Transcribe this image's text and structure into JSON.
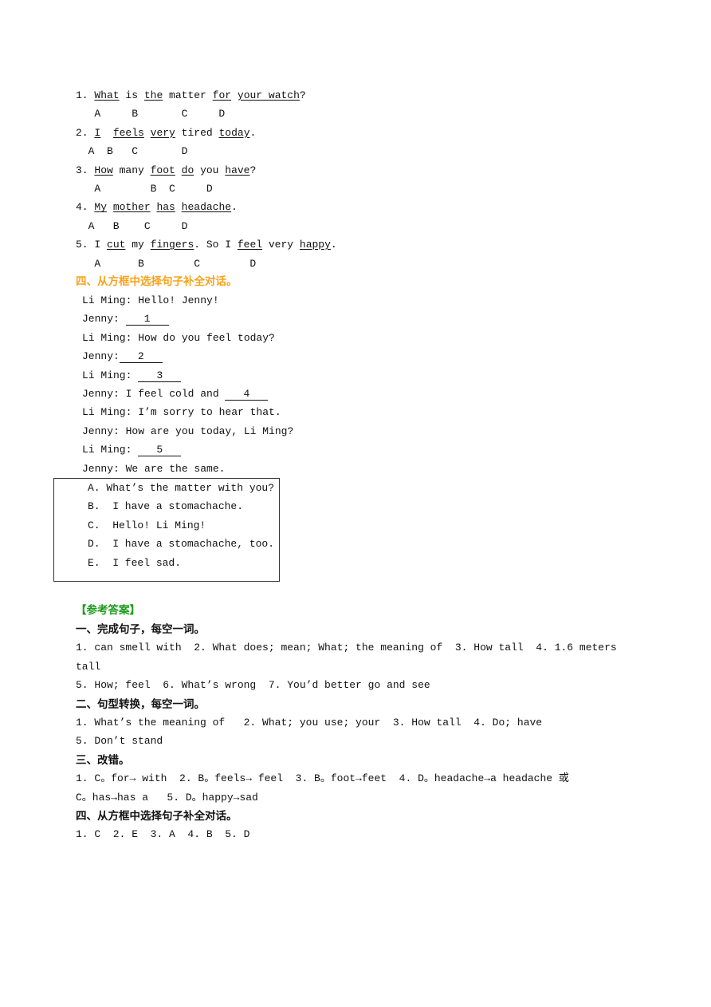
{
  "section3_questions": [
    {
      "parts": [
        {
          "t": "1. "
        },
        {
          "t": "What",
          "u": true
        },
        {
          "t": " is "
        },
        {
          "t": "the",
          "u": true
        },
        {
          "t": " matter "
        },
        {
          "t": "for",
          "u": true
        },
        {
          "t": " "
        },
        {
          "t": "your watch",
          "u": true
        },
        {
          "t": "?"
        }
      ],
      "letters": "   A     B       C     D"
    },
    {
      "parts": [
        {
          "t": "2. "
        },
        {
          "t": "I",
          "u": true
        },
        {
          "t": "  "
        },
        {
          "t": "feels",
          "u": true
        },
        {
          "t": " "
        },
        {
          "t": "very",
          "u": true
        },
        {
          "t": " tired "
        },
        {
          "t": "today",
          "u": true
        },
        {
          "t": "."
        }
      ],
      "letters": "  A  B   C       D"
    },
    {
      "parts": [
        {
          "t": "3. "
        },
        {
          "t": "How",
          "u": true
        },
        {
          "t": " many "
        },
        {
          "t": "foot",
          "u": true
        },
        {
          "t": " "
        },
        {
          "t": "do",
          "u": true
        },
        {
          "t": " you "
        },
        {
          "t": "have",
          "u": true
        },
        {
          "t": "?"
        }
      ],
      "letters": "   A        B  C     D"
    },
    {
      "parts": [
        {
          "t": "4. "
        },
        {
          "t": "My",
          "u": true
        },
        {
          "t": " "
        },
        {
          "t": "mother",
          "u": true
        },
        {
          "t": " "
        },
        {
          "t": "has",
          "u": true
        },
        {
          "t": " "
        },
        {
          "t": "headache",
          "u": true
        },
        {
          "t": "."
        }
      ],
      "letters": "  A   B    C     D"
    },
    {
      "parts": [
        {
          "t": "5. I "
        },
        {
          "t": "cut",
          "u": true
        },
        {
          "t": " my "
        },
        {
          "t": "fingers",
          "u": true
        },
        {
          "t": ". So I "
        },
        {
          "t": "feel",
          "u": true
        },
        {
          "t": " very "
        },
        {
          "t": "happy",
          "u": true
        },
        {
          "t": "."
        }
      ],
      "letters": "   A      B        C        D"
    }
  ],
  "section4": {
    "heading": "四、从方框中选择句子补全对话。",
    "dialogue": [
      {
        "text": "Li Ming: Hello! Jenny!"
      },
      {
        "text": "Jenny: ",
        "blank": "1"
      },
      {
        "text": "Li Ming: How do you feel today?"
      },
      {
        "text": "Jenny:",
        "blank": "2"
      },
      {
        "text": "Li Ming: ",
        "blank": "3"
      },
      {
        "text": "Jenny: I feel cold and ",
        "blank": "4"
      },
      {
        "text": "Li Ming: I’m sorry to hear that."
      },
      {
        "text": "Jenny: How are you today, Li Ming?"
      },
      {
        "text": "Li Ming: ",
        "blank": "5"
      },
      {
        "text": "Jenny: We are the same."
      }
    ],
    "options": [
      "A. What’s the matter with you?",
      "B.  I have a stomachache.",
      "C.  Hello! Li Ming!",
      "D.  I have a stomachache, too.",
      "E.  I feel sad."
    ]
  },
  "answers": {
    "title": "【参考答案】",
    "lines": [
      {
        "t": "一、完成句子，每空一词。",
        "h": true
      },
      {
        "t": "1. can smell with  2. What does; mean; What; the meaning of  3. How tall  4. 1.6 meters"
      },
      {
        "t": "tall"
      },
      {
        "t": "5. How; feel  6. What’s wrong  7. You’d better go and see"
      },
      {
        "t": "二、句型转换，每空一词。",
        "h": true
      },
      {
        "t": "1. What’s the meaning of   2. What; you use; your  3. How tall  4. Do; have"
      },
      {
        "t": "5. Don’t stand"
      },
      {
        "t": "三、改错。",
        "h": true
      },
      {
        "t": "1. C。for→ with  2. B。feels→ feel  3. B。foot→feet  4. D。headache→a headache 或"
      },
      {
        "t": "C。has→has a   5. D。happy→sad"
      },
      {
        "t": "四、从方框中选择句子补全对话。",
        "h": true
      },
      {
        "t": "1. C  2. E  3. A  4. B  5. D"
      }
    ]
  },
  "colors": {
    "section_heading": "#f7a21b",
    "answer_title": "#1e9a1e"
  }
}
